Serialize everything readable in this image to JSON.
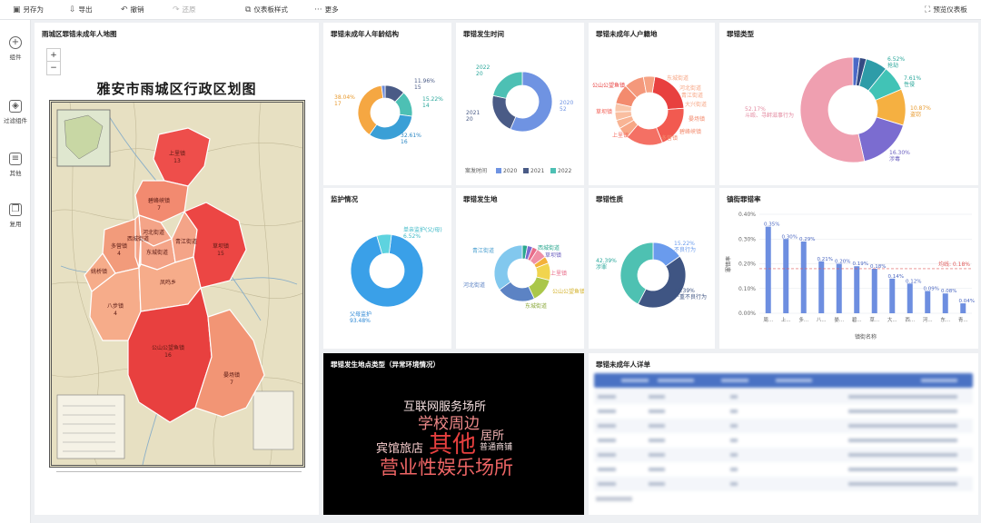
{
  "toolbar": {
    "save_as": "另存为",
    "export": "导出",
    "undo": "撤销",
    "redo": "还原",
    "dashboard_style": "仪表板样式",
    "more": "更多",
    "preview": "预览仪表板"
  },
  "sidebar": {
    "items": [
      {
        "label": "组件",
        "icon": "plus-circle-icon"
      },
      {
        "label": "过滤组件",
        "icon": "cube-icon"
      },
      {
        "label": "其他",
        "icon": "document-icon"
      },
      {
        "label": "复用",
        "icon": "copy-icon"
      }
    ]
  },
  "map_panel": {
    "title": "雨城区罪错未成年人地图",
    "zoom_in": "+",
    "zoom_out": "−",
    "map_title": "雅安市雨城区行政区划图",
    "regions": [
      {
        "name": "上里镇",
        "value": "13",
        "color": "#ee4e4b"
      },
      {
        "name": "碧峰峡镇",
        "value": "7",
        "color": "#f28a70"
      },
      {
        "name": "多营镇",
        "value": "4",
        "color": "#f29b7b"
      },
      {
        "name": "河北街道",
        "value": "",
        "color": "#f4a488"
      },
      {
        "name": "东城街道",
        "value": "",
        "color": "#f4a488"
      },
      {
        "name": "青江街道",
        "value": "",
        "color": "#f4a488"
      },
      {
        "name": "西城街道",
        "value": "",
        "color": "#f4a488"
      },
      {
        "name": "草坝镇",
        "value": "15",
        "color": "#ec4644"
      },
      {
        "name": "八步镇",
        "value": "4",
        "color": "#f6ac8a"
      },
      {
        "name": "姚桥镇",
        "value": "",
        "color": "#f6ac8a"
      },
      {
        "name": "凤鸣乡",
        "value": "",
        "color": "#f6ac8a"
      },
      {
        "name": "公山公望鱼镇",
        "value": "16",
        "color": "#e8403f"
      },
      {
        "name": "晏场镇",
        "value": "7",
        "color": "#f29575"
      }
    ]
  },
  "age_panel": {
    "title": "罪错未成年人年龄结构",
    "chart_data": {
      "type": "pie",
      "slices": [
        {
          "label": "11.96%\n15",
          "percent": 11.96,
          "value": 15,
          "color": "#4a5b86"
        },
        {
          "label": "15.22%\n14",
          "percent": 15.22,
          "value": 14,
          "color": "#4dc0b4"
        },
        {
          "label": "32.61%\n16",
          "percent": 32.61,
          "value": 16,
          "color": "#3a9fd6"
        },
        {
          "label": "38.04%\n17",
          "percent": 38.04,
          "value": 17,
          "color": "#f5a742"
        },
        {
          "label": "",
          "percent": 2.17,
          "value": 13,
          "color": "#6f8cd9"
        }
      ]
    }
  },
  "time_panel": {
    "title": "罪错发生时间",
    "chart_data": {
      "type": "pie",
      "slices": [
        {
          "label": "2020\n52",
          "value": 52,
          "color": "#6f93e2"
        },
        {
          "label": "2021\n20",
          "value": 20,
          "color": "#4a5b86"
        },
        {
          "label": "2022\n20",
          "value": 20,
          "color": "#4dc0b4"
        }
      ],
      "legend_title": "案发时间",
      "legend_position": "bottom"
    }
  },
  "hometown_panel": {
    "title": "罪错未成年人户籍地",
    "chart_data": {
      "type": "pie",
      "slices": [
        {
          "label": "公山公望鱼镇",
          "value": 16,
          "color": "#e8403f"
        },
        {
          "label": "草坝镇",
          "value": 15,
          "color": "#f25a50"
        },
        {
          "label": "上里镇",
          "value": 13,
          "color": "#f47064"
        },
        {
          "label": "东城街道",
          "value": 4,
          "color": "#f7a786"
        },
        {
          "label": "河北街道",
          "value": 3,
          "color": "#f8b494"
        },
        {
          "label": "青江街道",
          "value": 3,
          "color": "#f9bea0"
        },
        {
          "label": "大兴街道",
          "value": 3,
          "color": "#f9c6aa"
        },
        {
          "label": "晏场镇",
          "value": 7,
          "color": "#f38b6e"
        },
        {
          "label": "碧峰峡镇",
          "value": 7,
          "color": "#f4987b"
        },
        {
          "label": "多营镇",
          "value": 4,
          "color": "#f6a283"
        }
      ]
    }
  },
  "type_panel": {
    "title": "罪错类型",
    "chart_data": {
      "type": "pie",
      "slices": [
        {
          "label": "",
          "percent": 2.0,
          "color": "#4a69c6"
        },
        {
          "label": "",
          "percent": 2.0,
          "color": "#344a82"
        },
        {
          "label": "6.52%\n抢劫",
          "percent": 6.52,
          "color": "#2e9ca8"
        },
        {
          "label": "7.61%\n性侵",
          "percent": 7.61,
          "color": "#41c3b6"
        },
        {
          "label": "10.87%\n盗窃",
          "percent": 10.87,
          "color": "#f5b041"
        },
        {
          "label": "16.30%\n涉毒",
          "percent": 16.3,
          "color": "#7b6cd0"
        },
        {
          "label": "52.17%\n斗殴、寻衅滋事行为",
          "percent": 52.17,
          "color": "#ef9fb0"
        }
      ]
    }
  },
  "guardian_panel": {
    "title": "监护情况",
    "chart_data": {
      "type": "pie",
      "slices": [
        {
          "label": "父母监护\n93.48%",
          "percent": 93.48,
          "color": "#3aa0e8"
        },
        {
          "label": "单亲监护(父/母)\n6.52%",
          "percent": 6.52,
          "color": "#5ed3df"
        }
      ]
    }
  },
  "place_panel": {
    "title": "罪错发生地",
    "chart_data": {
      "type": "pie",
      "slices": [
        {
          "label": "西城街道",
          "percent": 3,
          "color": "#2aa78f"
        },
        {
          "label": "草坝镇",
          "percent": 3,
          "color": "#7b6cd0"
        },
        {
          "label": "",
          "percent": 3,
          "color": "#e86d8a"
        },
        {
          "label": "上里镇",
          "percent": 6,
          "color": "#f08fa5"
        },
        {
          "label": "",
          "percent": 4,
          "color": "#f4b13a"
        },
        {
          "label": "公山公望鱼镇",
          "percent": 10,
          "color": "#f1d44e"
        },
        {
          "label": "东城街道",
          "percent": 14,
          "color": "#aac74a"
        },
        {
          "label": "河北街道",
          "percent": 22,
          "color": "#5c83c4"
        },
        {
          "label": "青江街道",
          "percent": 35,
          "color": "#82c8ee"
        }
      ]
    }
  },
  "nature_panel": {
    "title": "罪错性质",
    "chart_data": {
      "type": "pie",
      "slices": [
        {
          "label": "15.22%\n不良行为",
          "percent": 15.22,
          "color": "#6a9bed"
        },
        {
          "label": "42.39%\n严重不良行为",
          "percent": 42.39,
          "color": "#3f5583"
        },
        {
          "label": "42.39%\n涉罪",
          "percent": 42.39,
          "color": "#4ec1b2"
        }
      ]
    }
  },
  "rate_panel": {
    "title": "镇街罪错率",
    "chart_data": {
      "type": "bar",
      "categories": [
        "周...",
        "上...",
        "多...",
        "八...",
        "晏...",
        "碧...",
        "草...",
        "大...",
        "西...",
        "河...",
        "东...",
        "青..."
      ],
      "values": [
        0.35,
        0.3,
        0.29,
        0.21,
        0.2,
        0.19,
        0.18,
        0.14,
        0.12,
        0.09,
        0.08,
        0.04
      ],
      "value_labels": [
        "0.35%",
        "0.30%",
        "0.29%",
        "0.21%",
        "0.20%",
        "0.19%",
        "0.18%",
        "0.14%",
        "0.12%",
        "0.09%",
        "0.08%",
        "0.04%"
      ],
      "ylim": [
        0,
        0.4
      ],
      "yticks": [
        "0.00%",
        "0.10%",
        "0.20%",
        "0.30%",
        "0.40%"
      ],
      "ytick_values": [
        0,
        0.1,
        0.2,
        0.3,
        0.4
      ],
      "ylabel": "罪错率",
      "xlabel": "镇街名称",
      "average": 0.18,
      "average_label": "均线: 0.18%",
      "bar_color": "#6d8ee0",
      "grid": true
    }
  },
  "wordcloud_panel": {
    "title": "罪错发生地点类型（异常环境情况）",
    "words": [
      {
        "text": "互联网服务场所",
        "color": "#f3dede"
      },
      {
        "text": "学校周边",
        "color": "#f08a8a"
      },
      {
        "text": "居所",
        "color": "#f0b2b2"
      },
      {
        "text": "宾馆旅店",
        "color": "#f6cccc"
      },
      {
        "text": "其他",
        "color": "#e8403f"
      },
      {
        "text": "普通商铺",
        "color": "#f6dede"
      },
      {
        "text": "营业性娱乐场所",
        "color": "#ee6565"
      }
    ]
  },
  "detail_panel": {
    "title": "罪错未成年人详单"
  }
}
